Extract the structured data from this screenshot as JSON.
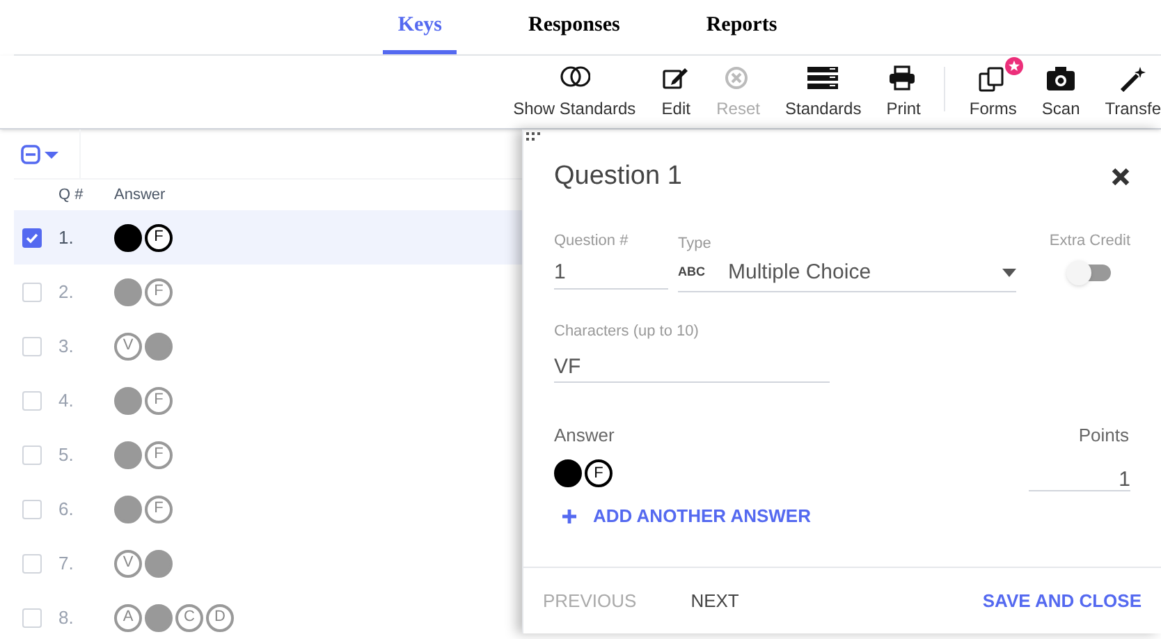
{
  "tabs": [
    {
      "label": "Keys",
      "selected": true
    },
    {
      "label": "Responses",
      "selected": false
    },
    {
      "label": "Reports",
      "selected": false
    }
  ],
  "toolbar": [
    {
      "label": "Show Standards",
      "disabled": false,
      "badge": false
    },
    {
      "label": "Edit",
      "disabled": false,
      "badge": false
    },
    {
      "label": "Reset",
      "disabled": true,
      "badge": false
    },
    {
      "label": "Standards",
      "disabled": false,
      "badge": false
    },
    {
      "label": "Print",
      "disabled": false,
      "badge": false
    },
    {
      "label": "Forms",
      "disabled": false,
      "badge": true
    },
    {
      "label": "Scan",
      "disabled": false,
      "badge": false
    },
    {
      "label": "Transfe",
      "disabled": false,
      "badge": false
    }
  ],
  "table": {
    "columns": [
      "Q #",
      "Answer"
    ],
    "rows": [
      {
        "number": "1.",
        "checked": true,
        "selected": true,
        "bubbles": [
          {
            "filled": true
          },
          {
            "letter": "F",
            "filled": false
          }
        ]
      },
      {
        "number": "2.",
        "checked": false,
        "selected": false,
        "bubbles": [
          {
            "filled": true
          },
          {
            "letter": "F",
            "filled": false
          }
        ]
      },
      {
        "number": "3.",
        "checked": false,
        "selected": false,
        "bubbles": [
          {
            "letter": "V",
            "filled": false
          },
          {
            "filled": true
          }
        ]
      },
      {
        "number": "4.",
        "checked": false,
        "selected": false,
        "bubbles": [
          {
            "filled": true
          },
          {
            "letter": "F",
            "filled": false
          }
        ]
      },
      {
        "number": "5.",
        "checked": false,
        "selected": false,
        "bubbles": [
          {
            "filled": true
          },
          {
            "letter": "F",
            "filled": false
          }
        ]
      },
      {
        "number": "6.",
        "checked": false,
        "selected": false,
        "bubbles": [
          {
            "filled": true
          },
          {
            "letter": "F",
            "filled": false
          }
        ]
      },
      {
        "number": "7.",
        "checked": false,
        "selected": false,
        "bubbles": [
          {
            "letter": "V",
            "filled": false
          },
          {
            "filled": true
          }
        ]
      },
      {
        "number": "8.",
        "checked": false,
        "selected": false,
        "bubbles": [
          {
            "letter": "A",
            "filled": false
          },
          {
            "filled": true
          },
          {
            "letter": "C",
            "filled": false
          },
          {
            "letter": "D",
            "filled": false
          }
        ]
      }
    ]
  },
  "panel": {
    "title": "Question 1",
    "question_label": "Question #",
    "question_value": "1",
    "type_label": "Type",
    "type_icon": "ABC",
    "type_value": "Multiple Choice",
    "extra_credit_label": "Extra Credit",
    "extra_credit_on": false,
    "characters_label": "Characters (up to 10)",
    "characters_value": "VF",
    "answer_label": "Answer",
    "answer_bubbles": [
      {
        "filled": true
      },
      {
        "letter": "F",
        "filled": false
      }
    ],
    "points_label": "Points",
    "points_value": "1",
    "add_answer": "ADD ANOTHER ANSWER",
    "previous": "PREVIOUS",
    "previous_disabled": true,
    "next": "NEXT",
    "save": "SAVE AND CLOSE"
  }
}
